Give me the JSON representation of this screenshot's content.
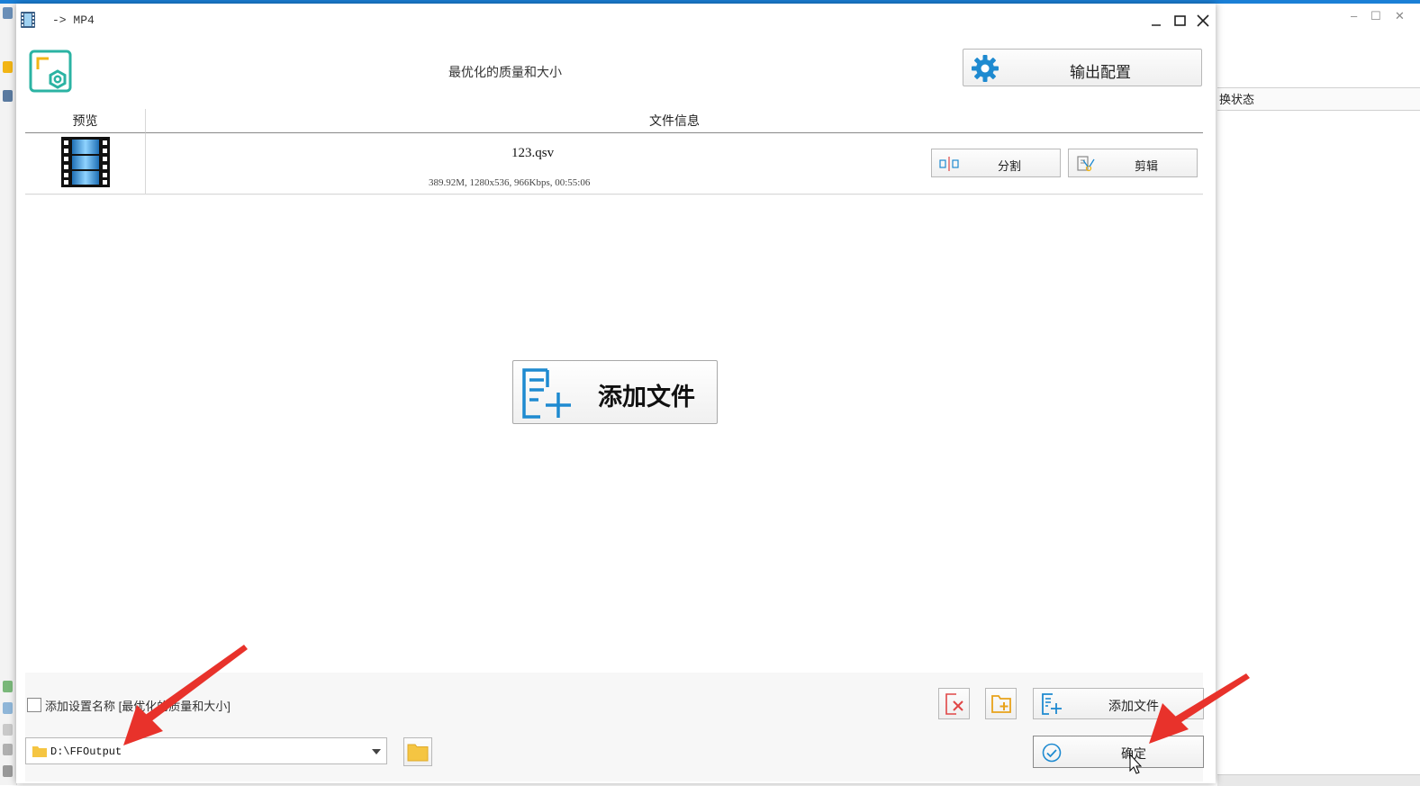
{
  "background_window": {
    "header_fragment": "换状态",
    "window_controls": [
      "–",
      "☐",
      "✕"
    ]
  },
  "dialog": {
    "title": "-> MP4",
    "preset_name": "最优化的质量和大小",
    "output_config_label": "输出配置",
    "table": {
      "headers": {
        "preview": "预览",
        "file_info": "文件信息"
      },
      "rows": [
        {
          "filename": "123.qsv",
          "meta": "389.92M, 1280x536, 966Kbps, 00:55:06",
          "split_label": "分割",
          "edit_label": "剪辑"
        }
      ]
    },
    "add_file_big_label": "添加文件",
    "bottom": {
      "add_setting_name_label": "添加设置名称 [最优化的质量和大小]",
      "add_setting_name_checked": false,
      "add_file_label": "添加文件",
      "output_path": "D:\\FFOutput",
      "ok_label": "确定"
    }
  },
  "colors": {
    "accent_blue": "#1e8ad0",
    "logo_teal": "#2bb3a3",
    "logo_yellow": "#f2b515",
    "annotation_red": "#e8322b",
    "remove_red": "#e04646",
    "folder_yellow": "#f5c542"
  },
  "icons": {
    "app": "film-icon",
    "logo": "format-factory-logo",
    "config": "gear-icon",
    "split": "split-icon",
    "edit": "clip-edit-icon",
    "add_file": "add-file-icon",
    "remove": "remove-file-icon",
    "add_folder": "add-folder-icon",
    "browse": "folder-icon",
    "ok": "check-circle-icon"
  }
}
